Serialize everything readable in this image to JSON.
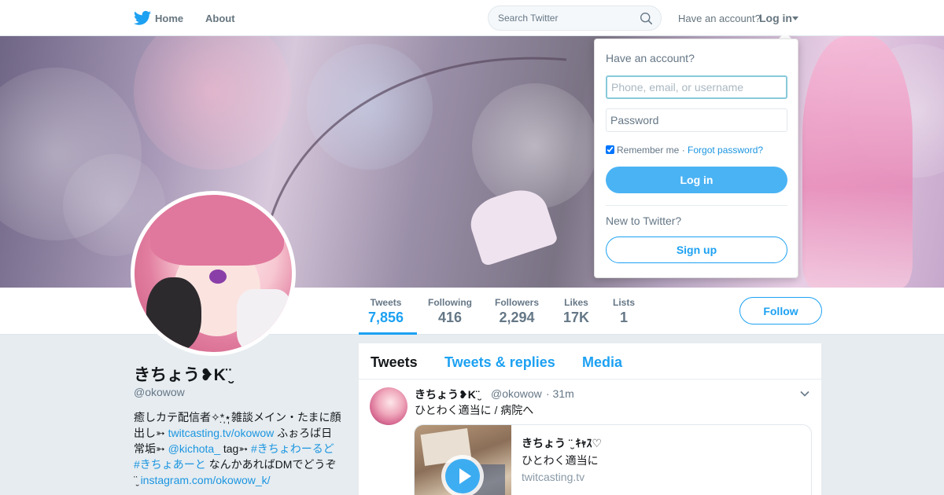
{
  "nav": {
    "home_label": "Home",
    "about_label": "About",
    "search_placeholder": "Search Twitter",
    "have_account": "Have an account?",
    "login_label": "Log in"
  },
  "profile": {
    "name": "きちょう❥K¨̮ ",
    "handle": "@okowow",
    "bio": {
      "text1": "癒しカテ配信者✧*̣̩⋆̩雑談メイン・たまに顔出し➳ ",
      "link1": "twitcasting.tv/okowow",
      "text2": " ふぉろば日常垢➳ ",
      "mention": "@kichota_",
      "text3": " tag➳ ",
      "hashtag1": "#きちょわーるど",
      "text4": " ",
      "hashtag2": "#きちょあーと",
      "text5": " なんかあればDMでどうぞ ¨̮ ",
      "link2": "instagram.com/okowow_k/"
    },
    "follow_label": "Follow"
  },
  "stats": [
    {
      "label": "Tweets",
      "value": "7,856"
    },
    {
      "label": "Following",
      "value": "416"
    },
    {
      "label": "Followers",
      "value": "2,294"
    },
    {
      "label": "Likes",
      "value": "17K"
    },
    {
      "label": "Lists",
      "value": "1"
    }
  ],
  "timeline": {
    "tabs": [
      "Tweets",
      "Tweets & replies",
      "Media"
    ],
    "tweet": {
      "name": "きちょう❥K¨̮ ",
      "handle": "@okowow",
      "time": "· 31m",
      "text": "ひとわく適当に / 病院へ",
      "card": {
        "title": "きちょう ¨̮  ｷｬｽ♡",
        "description": "ひとわく適当に",
        "domain": "twitcasting.tv"
      }
    }
  },
  "login_dropdown": {
    "title": "Have an account?",
    "username_placeholder": "Phone, email, or username",
    "password_placeholder": "Password",
    "remember_label": "Remember me",
    "separator": " · ",
    "forgot_label": "Forgot password?",
    "login_button": "Log in",
    "new_label": "New to Twitter?",
    "signup_button": "Sign up"
  },
  "colors": {
    "accent": "#1da1f2",
    "background": "#e6ecf0",
    "muted_text": "#657786"
  },
  "icons": [
    "twitter-bird-icon",
    "search-icon",
    "caret-down-icon",
    "play-icon"
  ]
}
